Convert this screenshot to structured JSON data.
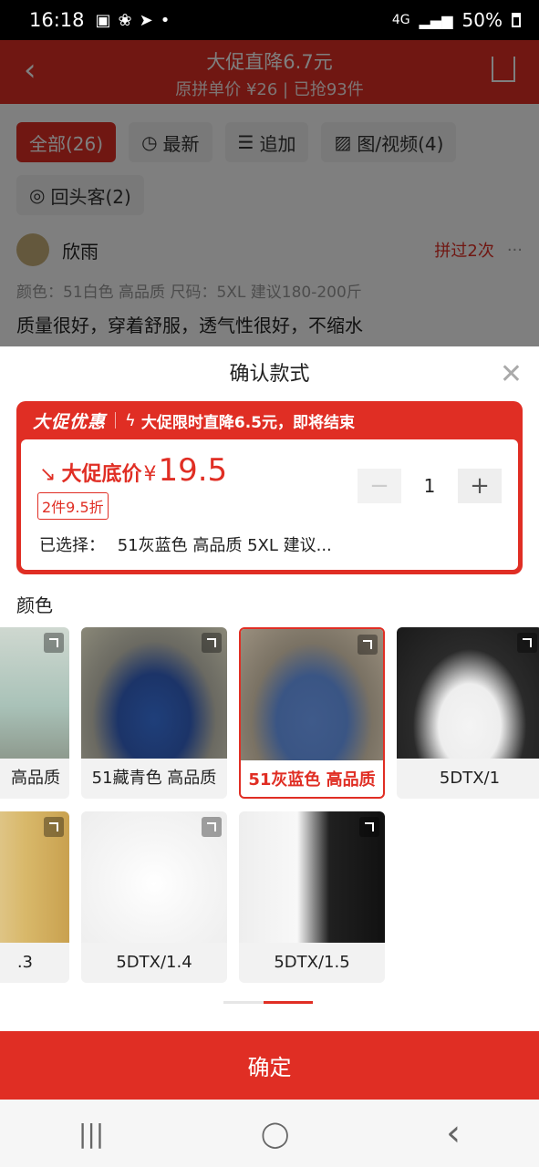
{
  "status_bar": {
    "time": "16:18",
    "network": "4G",
    "battery": "50%"
  },
  "background": {
    "header": {
      "line1": "大促直降6.7元",
      "line2": "原拼单价 ¥26 | 已抢93件"
    },
    "filters": [
      "全部(26)",
      "最新",
      "追加",
      "图/视频(4)",
      "回头客(2)"
    ],
    "review": {
      "user": "欣雨",
      "tag": "拼过2次",
      "more": "···",
      "spec": "颜色：51白色 高品质 尺码：5XL 建议180-200斤",
      "text": "质量很好，穿着舒服，透气性很好，不缩水"
    }
  },
  "sheet": {
    "title": "确认款式",
    "close": "✕",
    "promo": {
      "badge": "大促优惠",
      "message": "大促限时直降6.5元，即将结束",
      "price_label": "大促底价",
      "currency": "¥",
      "price": "19.5",
      "discount_tag": "2件9.5折",
      "selected_label": "已选择：",
      "selected_value": "51灰蓝色 高品质 5XL 建议..."
    },
    "quantity": {
      "minus": "−",
      "value": "1",
      "plus": "+"
    },
    "color_label": "颜色",
    "colors_row1": [
      "高品质",
      "51藏青色 高品质",
      "51灰蓝色 高品质",
      "5DTX/1"
    ],
    "colors_row2": [
      ".3",
      "5DTX/1.4",
      "5DTX/1.5"
    ],
    "confirm": "确定"
  },
  "nav": {
    "recent": "|||",
    "home": "◯",
    "back": "‹"
  },
  "colors": {
    "accent": "#e02e24"
  }
}
